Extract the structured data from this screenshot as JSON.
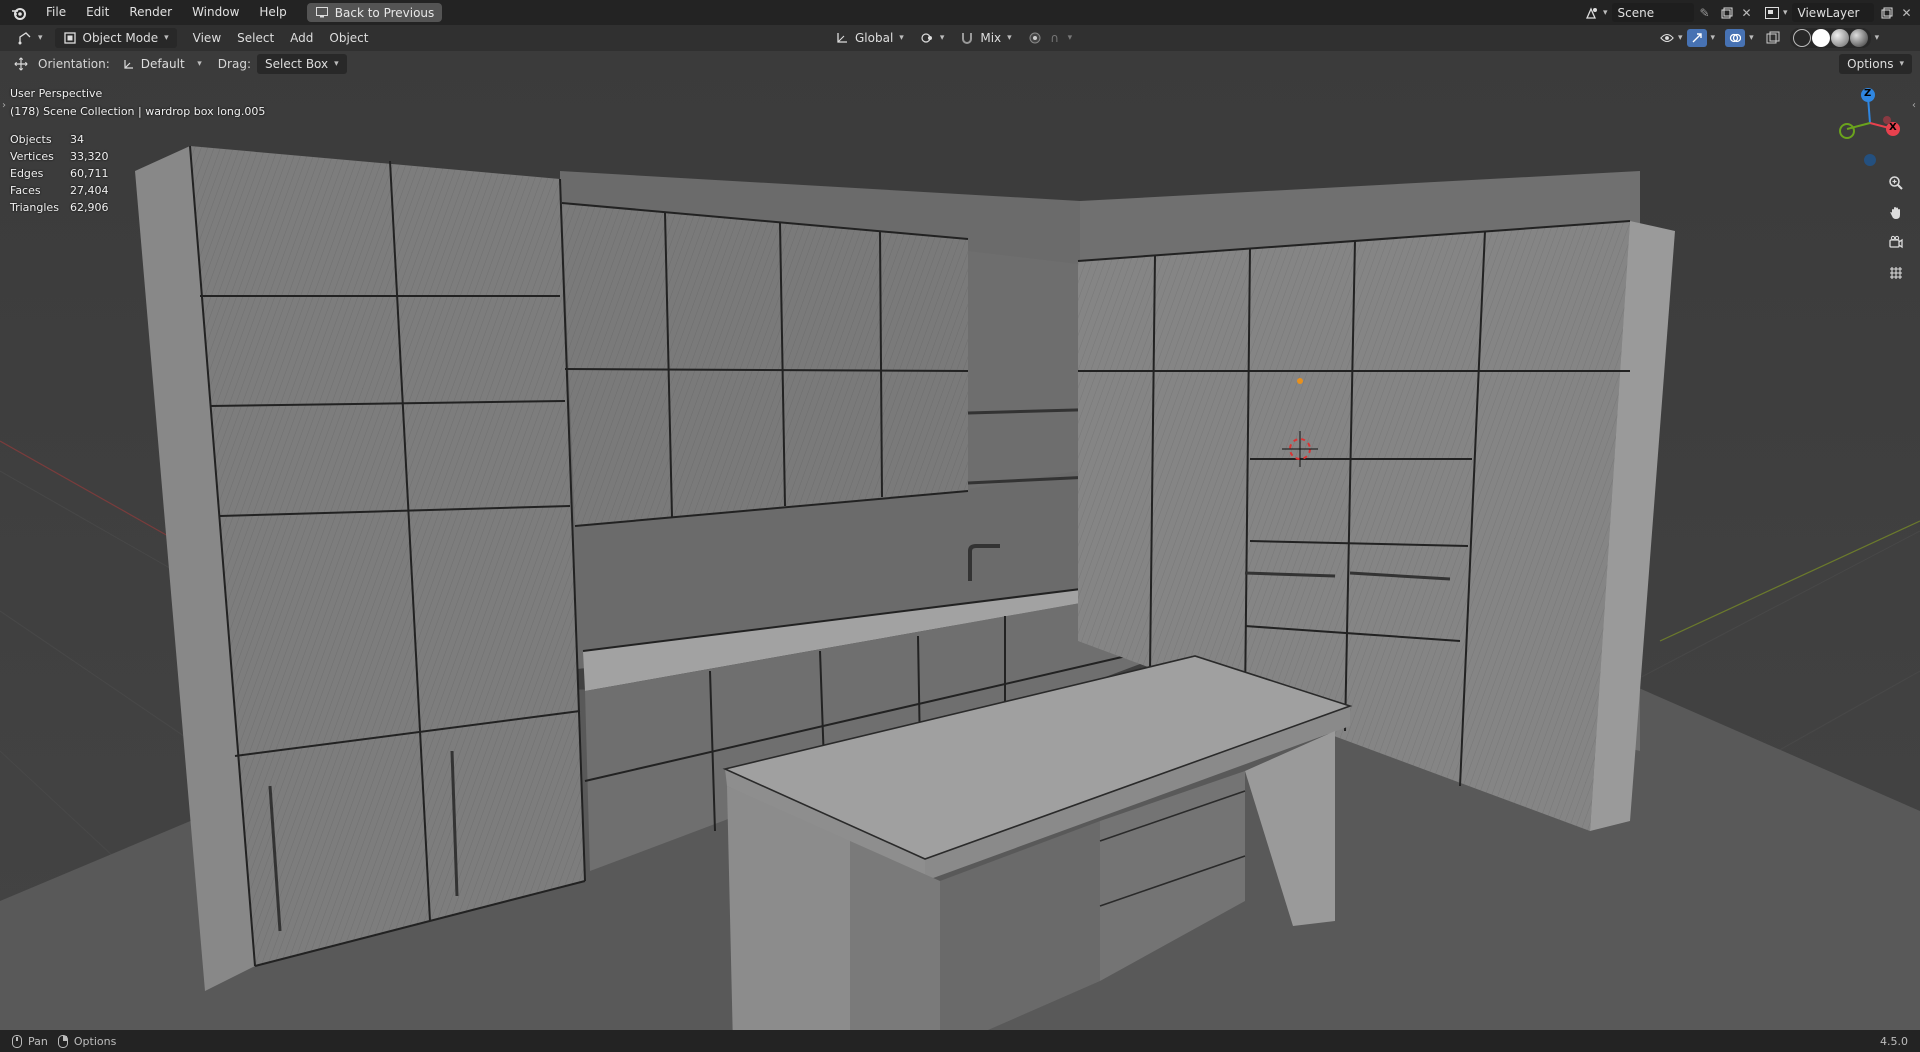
{
  "menu": {
    "items": [
      "File",
      "Edit",
      "Render",
      "Window",
      "Help"
    ],
    "back_button": "Back to Previous"
  },
  "scene": {
    "name": "Scene",
    "view_layer": "ViewLayer"
  },
  "header": {
    "mode": "Object Mode",
    "menus": [
      "View",
      "Select",
      "Add",
      "Object"
    ],
    "transform_orientation": "Global",
    "snap_mode": "Mix"
  },
  "tool_settings": {
    "orientation_label": "Orientation:",
    "orientation_value": "Default",
    "drag_label": "Drag:",
    "drag_value": "Select Box",
    "options_label": "Options"
  },
  "viewport": {
    "perspective": "User Perspective",
    "collection_info": "(178) Scene Collection | wardrop box long.005",
    "stats": [
      {
        "label": "Objects",
        "value": "34"
      },
      {
        "label": "Vertices",
        "value": "33,320"
      },
      {
        "label": "Edges",
        "value": "60,711"
      },
      {
        "label": "Faces",
        "value": "27,404"
      },
      {
        "label": "Triangles",
        "value": "62,906"
      }
    ],
    "gizmo_axes": {
      "z": "Z",
      "y": "Y",
      "x": "X"
    },
    "axis_colors": {
      "x": "#e8414e",
      "y": "#6aa31d",
      "z": "#2f86e0"
    }
  },
  "status_bar": {
    "pan_label": "Pan",
    "options_label": "Options",
    "version": "4.5.0"
  }
}
